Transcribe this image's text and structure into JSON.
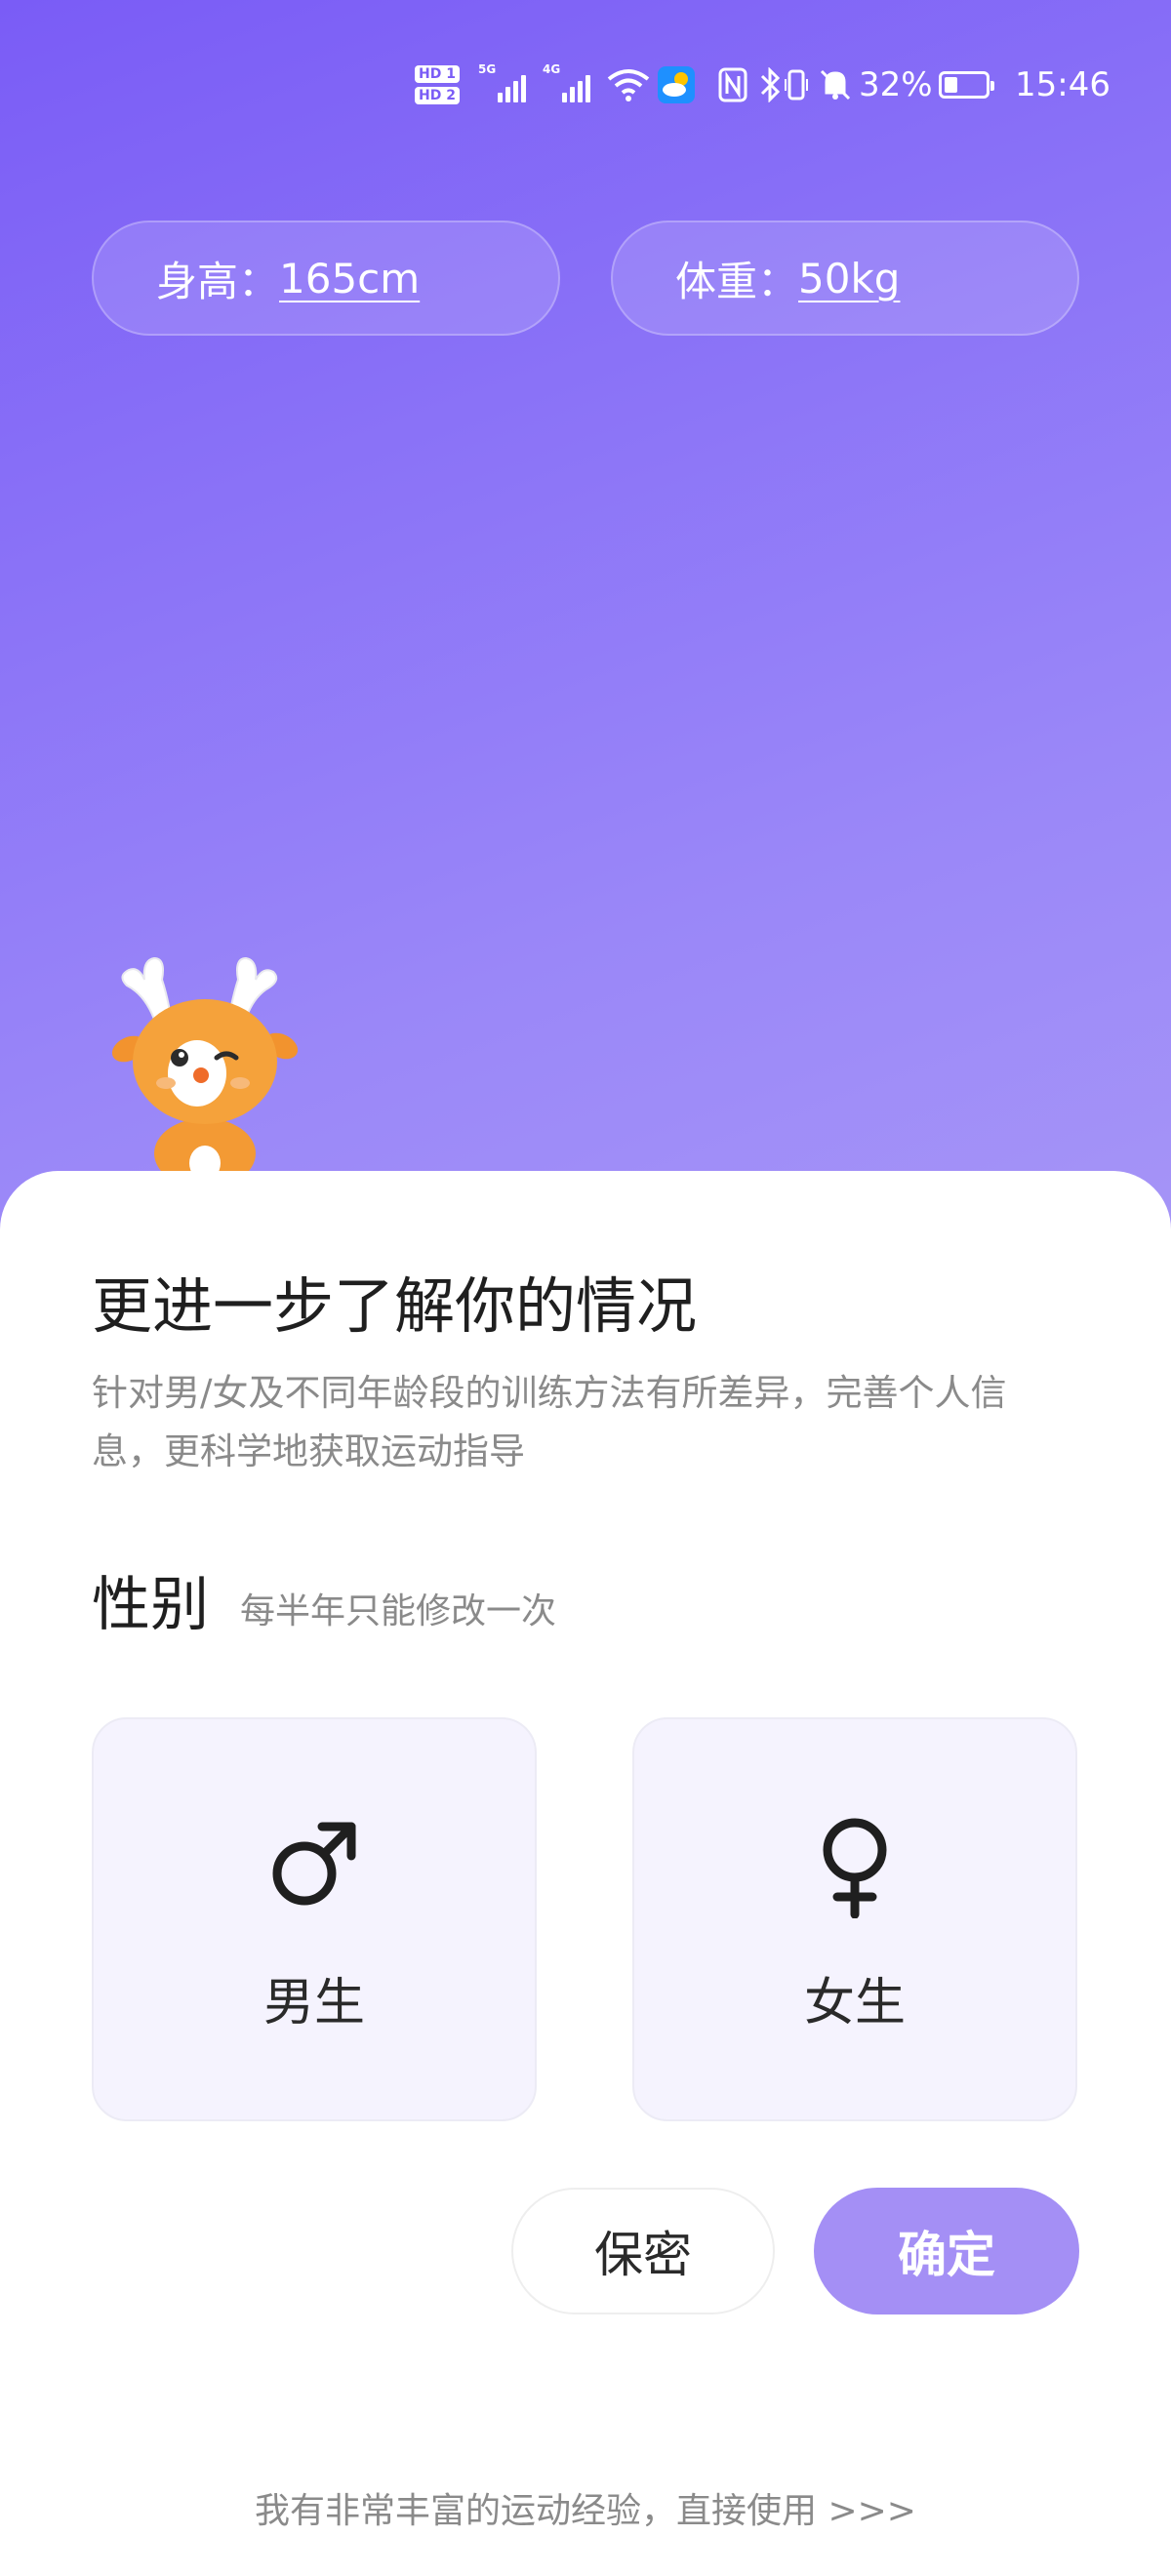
{
  "status_bar": {
    "hd1": "HD 1",
    "hd2": "HD 2",
    "net1": "5G",
    "net2": "4G",
    "battery_percent": "32%",
    "time": "15:46",
    "battery_level": 0.32,
    "icons": [
      "signal-icon",
      "wifi-icon",
      "weather-icon",
      "nfc-icon",
      "bluetooth-icon",
      "vibrate-icon",
      "mute-icon",
      "battery-icon"
    ]
  },
  "profile": {
    "height_label": "身高：",
    "height_value": "165cm",
    "weight_label": "体重：",
    "weight_value": "50kg"
  },
  "sheet": {
    "title": "更进一步了解你的情况",
    "description": "针对男/女及不同年龄段的训练方法有所差异，完善个人信息，更科学地获取运动指导",
    "gender_title": "性别",
    "gender_subtitle": "每半年只能修改一次",
    "male_label": "男生",
    "female_label": "女生",
    "secret_button": "保密",
    "confirm_button": "确定",
    "skip_link": "我有非常丰富的运动经验，直接使用 >>>"
  },
  "colors": {
    "accent": "#7a5cf6",
    "confirm_bg": "#a48ff5",
    "card_bg": "#f5f3fe"
  }
}
